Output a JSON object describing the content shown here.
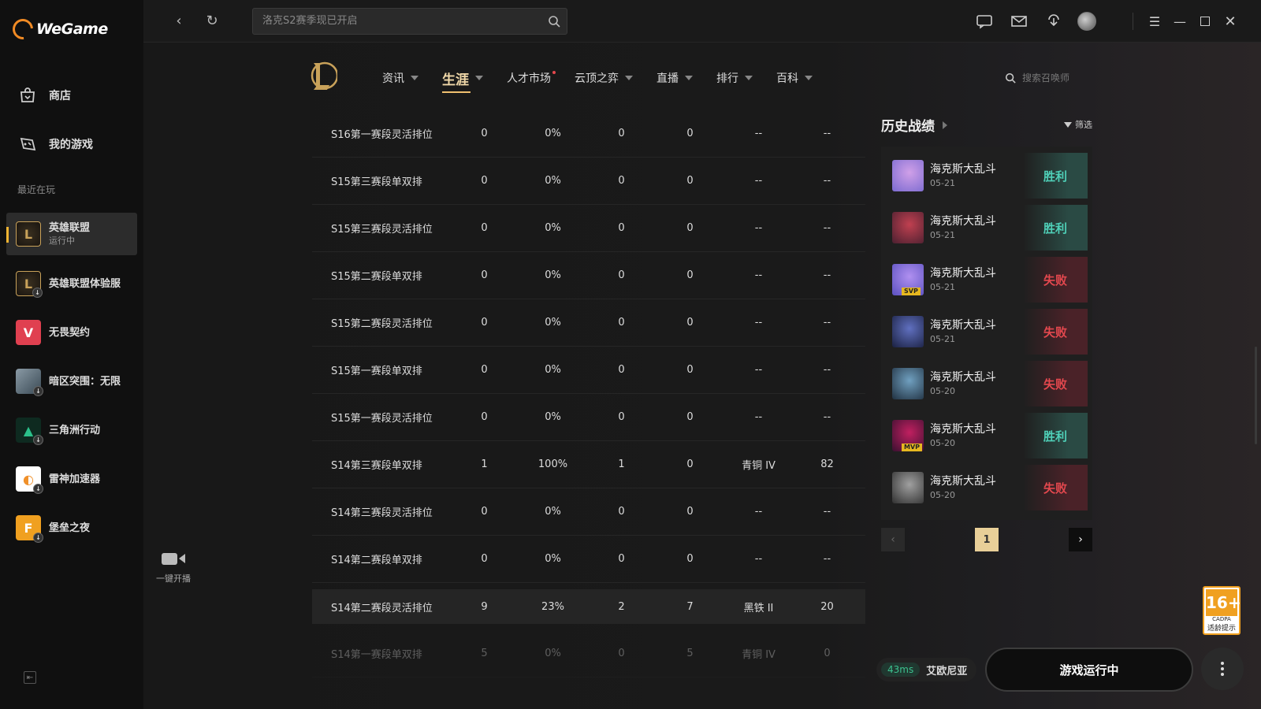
{
  "app": {
    "name": "WeGame"
  },
  "sidebar": {
    "nav": [
      {
        "label": "商店",
        "icon": "store-icon"
      },
      {
        "label": "我的游戏",
        "icon": "my-games-icon"
      }
    ],
    "recent_label": "最近在玩",
    "games": [
      {
        "name": "英雄联盟",
        "status": "运行中",
        "active": true,
        "color": "#c9a25a"
      },
      {
        "name": "英雄联盟体验服",
        "color": "#c9a25a"
      },
      {
        "name": "无畏契约",
        "color": "#e04050"
      },
      {
        "name": "暗区突围：无限",
        "color": "#8a9aa5"
      },
      {
        "name": "三角洲行动",
        "color": "#2bc08a"
      },
      {
        "name": "雷神加速器",
        "color": "#f0902a"
      },
      {
        "name": "堡垒之夜",
        "color": "#f0a020"
      }
    ],
    "broadcast_label": "一键开播"
  },
  "topbar": {
    "search_placeholder": "洛克S2赛季现已开启"
  },
  "game_nav": {
    "tabs": [
      {
        "label": "资讯",
        "caret": true
      },
      {
        "label": "生涯",
        "caret": true,
        "active": true
      },
      {
        "label": "人才市场",
        "dot": true
      },
      {
        "label": "云顶之弈",
        "caret": true
      },
      {
        "label": "直播",
        "caret": true
      },
      {
        "label": "排行",
        "caret": true
      },
      {
        "label": "百科",
        "caret": true
      }
    ],
    "summoner_search_placeholder": "搜索召唤师"
  },
  "season_table": {
    "rows": [
      {
        "name": "S16第一赛段灵活排位",
        "games": "0",
        "winrate": "0%",
        "wins": "0",
        "losses": "0",
        "rank": "--",
        "lp": "--"
      },
      {
        "name": "S15第三赛段单双排",
        "games": "0",
        "winrate": "0%",
        "wins": "0",
        "losses": "0",
        "rank": "--",
        "lp": "--"
      },
      {
        "name": "S15第三赛段灵活排位",
        "games": "0",
        "winrate": "0%",
        "wins": "0",
        "losses": "0",
        "rank": "--",
        "lp": "--"
      },
      {
        "name": "S15第二赛段单双排",
        "games": "0",
        "winrate": "0%",
        "wins": "0",
        "losses": "0",
        "rank": "--",
        "lp": "--"
      },
      {
        "name": "S15第二赛段灵活排位",
        "games": "0",
        "winrate": "0%",
        "wins": "0",
        "losses": "0",
        "rank": "--",
        "lp": "--"
      },
      {
        "name": "S15第一赛段单双排",
        "games": "0",
        "winrate": "0%",
        "wins": "0",
        "losses": "0",
        "rank": "--",
        "lp": "--"
      },
      {
        "name": "S15第一赛段灵活排位",
        "games": "0",
        "winrate": "0%",
        "wins": "0",
        "losses": "0",
        "rank": "--",
        "lp": "--"
      },
      {
        "name": "S14第三赛段单双排",
        "games": "1",
        "winrate": "100%",
        "wins": "1",
        "losses": "0",
        "rank": "青铜 IV",
        "lp": "82"
      },
      {
        "name": "S14第三赛段灵活排位",
        "games": "0",
        "winrate": "0%",
        "wins": "0",
        "losses": "0",
        "rank": "--",
        "lp": "--"
      },
      {
        "name": "S14第二赛段单双排",
        "games": "0",
        "winrate": "0%",
        "wins": "0",
        "losses": "0",
        "rank": "--",
        "lp": "--"
      },
      {
        "name": "S14第二赛段灵活排位",
        "games": "9",
        "winrate": "23%",
        "wins": "2",
        "losses": "7",
        "rank": "黑铁 II",
        "lp": "20",
        "highlight": true
      },
      {
        "name": "S14第一赛段单双排",
        "games": "5",
        "winrate": "0%",
        "wins": "0",
        "losses": "5",
        "rank": "青铜 IV",
        "lp": "0",
        "faded": true
      }
    ]
  },
  "history": {
    "title": "历史战绩",
    "filter_label": "筛选",
    "matches": [
      {
        "mode": "海克斯大乱斗",
        "date": "05-21",
        "result": "胜利",
        "win": true,
        "colors": [
          "#7a6ad0",
          "#d0a0e8"
        ],
        "badge": ""
      },
      {
        "mode": "海克斯大乱斗",
        "date": "05-21",
        "result": "胜利",
        "win": true,
        "colors": [
          "#4a2030",
          "#c04050"
        ],
        "badge": ""
      },
      {
        "mode": "海克斯大乱斗",
        "date": "05-21",
        "result": "失败",
        "win": false,
        "colors": [
          "#5a50c0",
          "#b090f0"
        ],
        "badge": "SVP"
      },
      {
        "mode": "海克斯大乱斗",
        "date": "05-21",
        "result": "失败",
        "win": false,
        "colors": [
          "#1a2040",
          "#6070c0"
        ],
        "badge": ""
      },
      {
        "mode": "海克斯大乱斗",
        "date": "05-20",
        "result": "失败",
        "win": false,
        "colors": [
          "#203040",
          "#70a0c0"
        ],
        "badge": ""
      },
      {
        "mode": "海克斯大乱斗",
        "date": "05-20",
        "result": "胜利",
        "win": true,
        "colors": [
          "#3a1030",
          "#c02060"
        ],
        "badge": "MVP"
      },
      {
        "mode": "海克斯大乱斗",
        "date": "05-20",
        "result": "失败",
        "win": false,
        "colors": [
          "#303030",
          "#a0a0a0"
        ],
        "badge": ""
      }
    ],
    "page": "1"
  },
  "footer": {
    "latency": "43ms",
    "server": "艾欧尼亚",
    "run_label": "游戏运行中",
    "age_rating": "16+",
    "age_sub": "CADPA",
    "age_note": "适龄提示"
  }
}
